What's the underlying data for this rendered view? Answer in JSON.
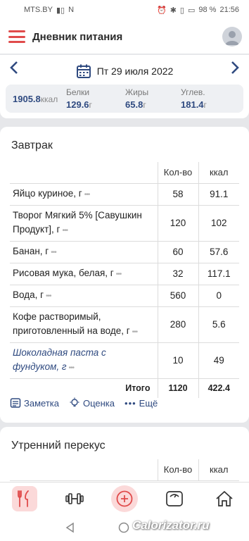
{
  "status": {
    "carrier": "MTS.BY",
    "battery": "98 %",
    "time": "21:56"
  },
  "appbar": {
    "title": "Дневник питания"
  },
  "date": {
    "label": "Пт 29 июля 2022"
  },
  "summary": {
    "kcal_value": "1905.8",
    "kcal_unit": "ккал",
    "protein_label": "Белки",
    "protein_value": "129.6",
    "protein_unit": "г",
    "fat_label": "Жиры",
    "fat_value": "65.8",
    "fat_unit": "г",
    "carb_label": "Углев.",
    "carb_value": "181.4",
    "carb_unit": "г"
  },
  "breakfast": {
    "title": "Завтрак",
    "col_qty": "Кол-во",
    "col_kcal": "ккал",
    "items": [
      {
        "name": "Яйцо куриное, г",
        "qty": "58",
        "kcal": "91.1"
      },
      {
        "name": "Творог Мягкий 5% [Савушкин Продукт], г",
        "qty": "120",
        "kcal": "102"
      },
      {
        "name": "Банан, г",
        "qty": "60",
        "kcal": "57.6"
      },
      {
        "name": "Рисовая мука, белая, г",
        "qty": "32",
        "kcal": "117.1"
      },
      {
        "name": "Вода, г",
        "qty": "560",
        "kcal": "0"
      },
      {
        "name": "Кофе растворимый, приготовленный на воде, г",
        "qty": "280",
        "kcal": "5.6"
      },
      {
        "name": "Шоколадная паста с фундуком, г",
        "qty": "10",
        "kcal": "49"
      }
    ],
    "total_label": "Итого",
    "total_qty": "1120",
    "total_kcal": "422.4"
  },
  "actions": {
    "note": "Заметка",
    "rate": "Оценка",
    "more": "Ещё"
  },
  "snack": {
    "title": "Утренний перекус",
    "col_qty": "Кол-во",
    "col_kcal": "ккал"
  },
  "watermark": "Calorizator.ru",
  "colors": {
    "accent": "#e04b4b",
    "link": "#2f4a80",
    "active_bg": "#fbd9d9"
  }
}
